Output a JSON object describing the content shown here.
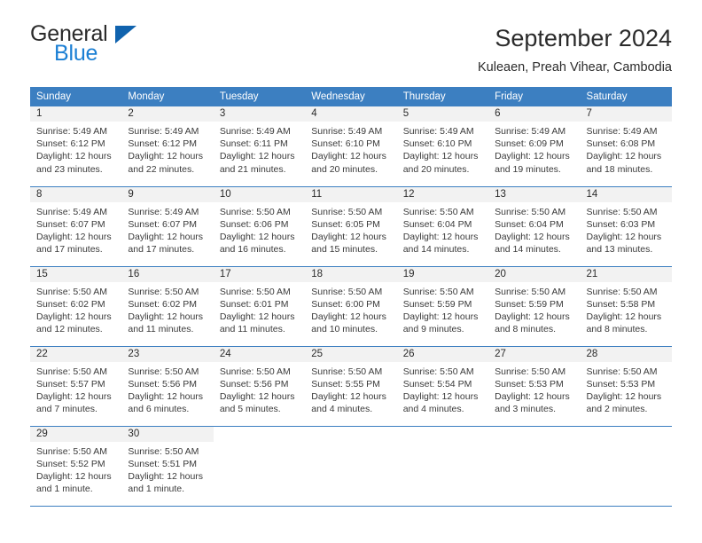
{
  "brand": {
    "name_part1": "General",
    "name_part2": "Blue",
    "logo_icon": "triangle-logo-icon"
  },
  "header": {
    "title": "September 2024",
    "subtitle": "Kuleaen, Preah Vihear, Cambodia"
  },
  "colors": {
    "header_blue": "#3c7fc1",
    "brand_blue": "#1b7fd4",
    "logo_blue": "#1063ae",
    "day_band_gray": "#f2f2f2",
    "text": "#2b2b2b"
  },
  "weekday_headers": [
    "Sunday",
    "Monday",
    "Tuesday",
    "Wednesday",
    "Thursday",
    "Friday",
    "Saturday"
  ],
  "weeks": [
    [
      {
        "day": "1",
        "sunrise": "Sunrise: 5:49 AM",
        "sunset": "Sunset: 6:12 PM",
        "daylight_line1": "Daylight: 12 hours",
        "daylight_line2": "and 23 minutes."
      },
      {
        "day": "2",
        "sunrise": "Sunrise: 5:49 AM",
        "sunset": "Sunset: 6:12 PM",
        "daylight_line1": "Daylight: 12 hours",
        "daylight_line2": "and 22 minutes."
      },
      {
        "day": "3",
        "sunrise": "Sunrise: 5:49 AM",
        "sunset": "Sunset: 6:11 PM",
        "daylight_line1": "Daylight: 12 hours",
        "daylight_line2": "and 21 minutes."
      },
      {
        "day": "4",
        "sunrise": "Sunrise: 5:49 AM",
        "sunset": "Sunset: 6:10 PM",
        "daylight_line1": "Daylight: 12 hours",
        "daylight_line2": "and 20 minutes."
      },
      {
        "day": "5",
        "sunrise": "Sunrise: 5:49 AM",
        "sunset": "Sunset: 6:10 PM",
        "daylight_line1": "Daylight: 12 hours",
        "daylight_line2": "and 20 minutes."
      },
      {
        "day": "6",
        "sunrise": "Sunrise: 5:49 AM",
        "sunset": "Sunset: 6:09 PM",
        "daylight_line1": "Daylight: 12 hours",
        "daylight_line2": "and 19 minutes."
      },
      {
        "day": "7",
        "sunrise": "Sunrise: 5:49 AM",
        "sunset": "Sunset: 6:08 PM",
        "daylight_line1": "Daylight: 12 hours",
        "daylight_line2": "and 18 minutes."
      }
    ],
    [
      {
        "day": "8",
        "sunrise": "Sunrise: 5:49 AM",
        "sunset": "Sunset: 6:07 PM",
        "daylight_line1": "Daylight: 12 hours",
        "daylight_line2": "and 17 minutes."
      },
      {
        "day": "9",
        "sunrise": "Sunrise: 5:49 AM",
        "sunset": "Sunset: 6:07 PM",
        "daylight_line1": "Daylight: 12 hours",
        "daylight_line2": "and 17 minutes."
      },
      {
        "day": "10",
        "sunrise": "Sunrise: 5:50 AM",
        "sunset": "Sunset: 6:06 PM",
        "daylight_line1": "Daylight: 12 hours",
        "daylight_line2": "and 16 minutes."
      },
      {
        "day": "11",
        "sunrise": "Sunrise: 5:50 AM",
        "sunset": "Sunset: 6:05 PM",
        "daylight_line1": "Daylight: 12 hours",
        "daylight_line2": "and 15 minutes."
      },
      {
        "day": "12",
        "sunrise": "Sunrise: 5:50 AM",
        "sunset": "Sunset: 6:04 PM",
        "daylight_line1": "Daylight: 12 hours",
        "daylight_line2": "and 14 minutes."
      },
      {
        "day": "13",
        "sunrise": "Sunrise: 5:50 AM",
        "sunset": "Sunset: 6:04 PM",
        "daylight_line1": "Daylight: 12 hours",
        "daylight_line2": "and 14 minutes."
      },
      {
        "day": "14",
        "sunrise": "Sunrise: 5:50 AM",
        "sunset": "Sunset: 6:03 PM",
        "daylight_line1": "Daylight: 12 hours",
        "daylight_line2": "and 13 minutes."
      }
    ],
    [
      {
        "day": "15",
        "sunrise": "Sunrise: 5:50 AM",
        "sunset": "Sunset: 6:02 PM",
        "daylight_line1": "Daylight: 12 hours",
        "daylight_line2": "and 12 minutes."
      },
      {
        "day": "16",
        "sunrise": "Sunrise: 5:50 AM",
        "sunset": "Sunset: 6:02 PM",
        "daylight_line1": "Daylight: 12 hours",
        "daylight_line2": "and 11 minutes."
      },
      {
        "day": "17",
        "sunrise": "Sunrise: 5:50 AM",
        "sunset": "Sunset: 6:01 PM",
        "daylight_line1": "Daylight: 12 hours",
        "daylight_line2": "and 11 minutes."
      },
      {
        "day": "18",
        "sunrise": "Sunrise: 5:50 AM",
        "sunset": "Sunset: 6:00 PM",
        "daylight_line1": "Daylight: 12 hours",
        "daylight_line2": "and 10 minutes."
      },
      {
        "day": "19",
        "sunrise": "Sunrise: 5:50 AM",
        "sunset": "Sunset: 5:59 PM",
        "daylight_line1": "Daylight: 12 hours",
        "daylight_line2": "and 9 minutes."
      },
      {
        "day": "20",
        "sunrise": "Sunrise: 5:50 AM",
        "sunset": "Sunset: 5:59 PM",
        "daylight_line1": "Daylight: 12 hours",
        "daylight_line2": "and 8 minutes."
      },
      {
        "day": "21",
        "sunrise": "Sunrise: 5:50 AM",
        "sunset": "Sunset: 5:58 PM",
        "daylight_line1": "Daylight: 12 hours",
        "daylight_line2": "and 8 minutes."
      }
    ],
    [
      {
        "day": "22",
        "sunrise": "Sunrise: 5:50 AM",
        "sunset": "Sunset: 5:57 PM",
        "daylight_line1": "Daylight: 12 hours",
        "daylight_line2": "and 7 minutes."
      },
      {
        "day": "23",
        "sunrise": "Sunrise: 5:50 AM",
        "sunset": "Sunset: 5:56 PM",
        "daylight_line1": "Daylight: 12 hours",
        "daylight_line2": "and 6 minutes."
      },
      {
        "day": "24",
        "sunrise": "Sunrise: 5:50 AM",
        "sunset": "Sunset: 5:56 PM",
        "daylight_line1": "Daylight: 12 hours",
        "daylight_line2": "and 5 minutes."
      },
      {
        "day": "25",
        "sunrise": "Sunrise: 5:50 AM",
        "sunset": "Sunset: 5:55 PM",
        "daylight_line1": "Daylight: 12 hours",
        "daylight_line2": "and 4 minutes."
      },
      {
        "day": "26",
        "sunrise": "Sunrise: 5:50 AM",
        "sunset": "Sunset: 5:54 PM",
        "daylight_line1": "Daylight: 12 hours",
        "daylight_line2": "and 4 minutes."
      },
      {
        "day": "27",
        "sunrise": "Sunrise: 5:50 AM",
        "sunset": "Sunset: 5:53 PM",
        "daylight_line1": "Daylight: 12 hours",
        "daylight_line2": "and 3 minutes."
      },
      {
        "day": "28",
        "sunrise": "Sunrise: 5:50 AM",
        "sunset": "Sunset: 5:53 PM",
        "daylight_line1": "Daylight: 12 hours",
        "daylight_line2": "and 2 minutes."
      }
    ],
    [
      {
        "day": "29",
        "sunrise": "Sunrise: 5:50 AM",
        "sunset": "Sunset: 5:52 PM",
        "daylight_line1": "Daylight: 12 hours",
        "daylight_line2": "and 1 minute."
      },
      {
        "day": "30",
        "sunrise": "Sunrise: 5:50 AM",
        "sunset": "Sunset: 5:51 PM",
        "daylight_line1": "Daylight: 12 hours",
        "daylight_line2": "and 1 minute."
      },
      {
        "day": "",
        "sunrise": "",
        "sunset": "",
        "daylight_line1": "",
        "daylight_line2": ""
      },
      {
        "day": "",
        "sunrise": "",
        "sunset": "",
        "daylight_line1": "",
        "daylight_line2": ""
      },
      {
        "day": "",
        "sunrise": "",
        "sunset": "",
        "daylight_line1": "",
        "daylight_line2": ""
      },
      {
        "day": "",
        "sunrise": "",
        "sunset": "",
        "daylight_line1": "",
        "daylight_line2": ""
      },
      {
        "day": "",
        "sunrise": "",
        "sunset": "",
        "daylight_line1": "",
        "daylight_line2": ""
      }
    ]
  ]
}
